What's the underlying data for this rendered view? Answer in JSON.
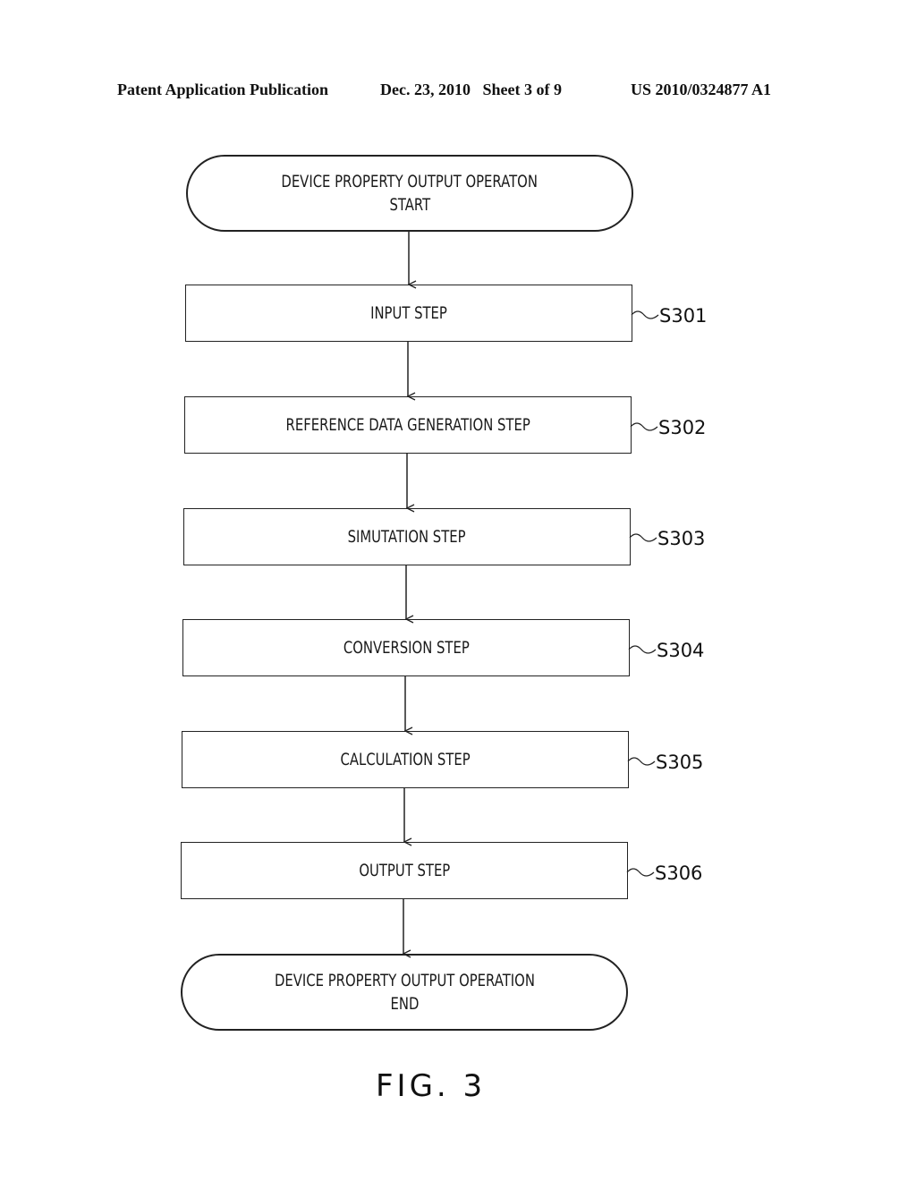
{
  "header": {
    "left": "Patent Application Publication",
    "middle": "Dec. 23, 2010   Sheet 3 of 9",
    "right": "US 2010/0324877 A1"
  },
  "flowchart": {
    "start": {
      "line1": "DEVICE PROPERTY OUTPUT OPERATON",
      "line2": "START"
    },
    "steps": [
      {
        "label": "INPUT STEP",
        "ref": "S301"
      },
      {
        "label": "REFERENCE DATA GENERATION STEP",
        "ref": "S302"
      },
      {
        "label": "SIMUTATION STEP",
        "ref": "S303"
      },
      {
        "label": "CONVERSION STEP",
        "ref": "S304"
      },
      {
        "label": "CALCULATION STEP",
        "ref": "S305"
      },
      {
        "label": "OUTPUT STEP",
        "ref": "S306"
      }
    ],
    "end": {
      "line1": "DEVICE PROPERTY OUTPUT OPERATION",
      "line2": "END"
    }
  },
  "figure_label": "FIG. 3"
}
